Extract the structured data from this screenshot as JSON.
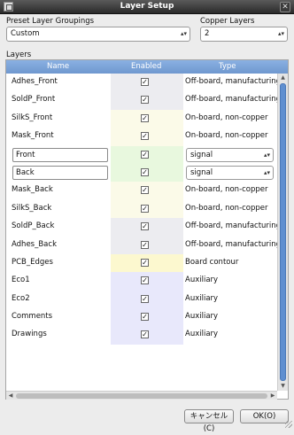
{
  "window": {
    "title": "Layer Setup"
  },
  "preset": {
    "label": "Preset Layer Groupings",
    "value": "Custom"
  },
  "copper": {
    "label": "Copper Layers",
    "value": "2"
  },
  "layers": {
    "label": "Layers",
    "columns": [
      "Name",
      "Enabled",
      "Type"
    ],
    "rows": [
      {
        "name": "Adhes_Front",
        "enabled": true,
        "type": "Off-board, manufacturing",
        "color": "#ececf0",
        "editable": false
      },
      {
        "name": "SoldP_Front",
        "enabled": true,
        "type": "Off-board, manufacturing",
        "color": "#ececf0",
        "editable": false
      },
      {
        "name": "SilkS_Front",
        "enabled": true,
        "type": "On-board, non-copper",
        "color": "#fbfae8",
        "editable": false
      },
      {
        "name": "Mask_Front",
        "enabled": true,
        "type": "On-board, non-copper",
        "color": "#fbfae8",
        "editable": false
      },
      {
        "name": "Front",
        "enabled": true,
        "type": "signal",
        "color": "#e8f8de",
        "editable": true
      },
      {
        "name": "Back",
        "enabled": true,
        "type": "signal",
        "color": "#e8f8de",
        "editable": true
      },
      {
        "name": "Mask_Back",
        "enabled": true,
        "type": "On-board, non-copper",
        "color": "#fbfae8",
        "editable": false
      },
      {
        "name": "SilkS_Back",
        "enabled": true,
        "type": "On-board, non-copper",
        "color": "#fbfae8",
        "editable": false
      },
      {
        "name": "SoldP_Back",
        "enabled": true,
        "type": "Off-board, manufacturing",
        "color": "#ececf0",
        "editable": false
      },
      {
        "name": "Adhes_Back",
        "enabled": true,
        "type": "Off-board, manufacturing",
        "color": "#ececf0",
        "editable": false
      },
      {
        "name": "PCB_Edges",
        "enabled": true,
        "type": "Board contour",
        "color": "#fcf8cf",
        "editable": false
      },
      {
        "name": "Eco1",
        "enabled": true,
        "type": "Auxiliary",
        "color": "#e8e8fb",
        "editable": false
      },
      {
        "name": "Eco2",
        "enabled": true,
        "type": "Auxiliary",
        "color": "#e8e8fb",
        "editable": false
      },
      {
        "name": "Comments",
        "enabled": true,
        "type": "Auxiliary",
        "color": "#e8e8fb",
        "editable": false
      },
      {
        "name": "Drawings",
        "enabled": true,
        "type": "Auxiliary",
        "color": "#e8e8fb",
        "editable": false
      }
    ]
  },
  "buttons": {
    "cancel": "キャンセル(C)",
    "ok": "OK(O)"
  },
  "icons": {
    "check": "✓",
    "combo_arrow": "⌃⌄",
    "scroll_up": "▲",
    "scroll_down": "▼",
    "scroll_left": "◀",
    "scroll_right": "▶",
    "close": "✕"
  }
}
